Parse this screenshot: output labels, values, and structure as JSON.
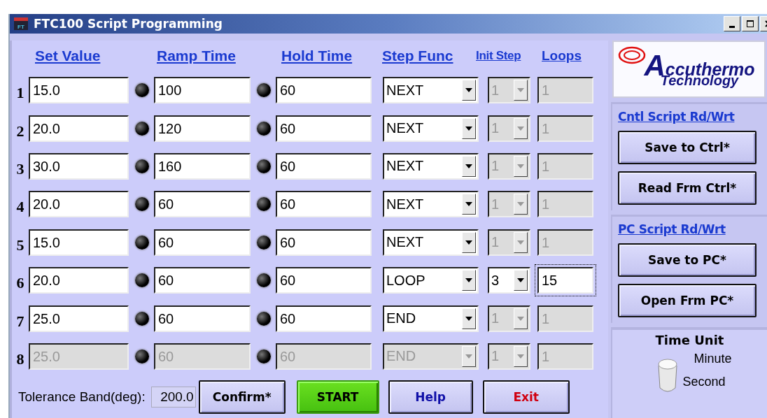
{
  "window": {
    "title": "FTC100 Script Programming",
    "icon_text": "FT"
  },
  "headers": [
    "Set Value",
    "Ramp Time",
    "Hold Time",
    "Step Func",
    "Init Step",
    "Loops"
  ],
  "rows": [
    {
      "number": "1",
      "set_value": "15.0",
      "ramp_time": "100",
      "hold_time": "60",
      "step_func": "NEXT",
      "init_step": "1",
      "loops": "1",
      "disabled": false,
      "loop_enabled": false,
      "focused": false
    },
    {
      "number": "2",
      "set_value": "20.0",
      "ramp_time": "120",
      "hold_time": "60",
      "step_func": "NEXT",
      "init_step": "1",
      "loops": "1",
      "disabled": false,
      "loop_enabled": false,
      "focused": false
    },
    {
      "number": "3",
      "set_value": "30.0",
      "ramp_time": "160",
      "hold_time": "60",
      "step_func": "NEXT",
      "init_step": "1",
      "loops": "1",
      "disabled": false,
      "loop_enabled": false,
      "focused": false
    },
    {
      "number": "4",
      "set_value": "20.0",
      "ramp_time": "60",
      "hold_time": "60",
      "step_func": "NEXT",
      "init_step": "1",
      "loops": "1",
      "disabled": false,
      "loop_enabled": false,
      "focused": false
    },
    {
      "number": "5",
      "set_value": "15.0",
      "ramp_time": "60",
      "hold_time": "60",
      "step_func": "NEXT",
      "init_step": "1",
      "loops": "1",
      "disabled": false,
      "loop_enabled": false,
      "focused": false
    },
    {
      "number": "6",
      "set_value": "20.0",
      "ramp_time": "60",
      "hold_time": "60",
      "step_func": "LOOP",
      "init_step": "3",
      "loops": "15",
      "disabled": false,
      "loop_enabled": true,
      "focused": true
    },
    {
      "number": "7",
      "set_value": "25.0",
      "ramp_time": "60",
      "hold_time": "60",
      "step_func": "END",
      "init_step": "1",
      "loops": "1",
      "disabled": false,
      "loop_enabled": false,
      "focused": false
    },
    {
      "number": "8",
      "set_value": "25.0",
      "ramp_time": "60",
      "hold_time": "60",
      "step_func": "END",
      "init_step": "1",
      "loops": "1",
      "disabled": true,
      "loop_enabled": false,
      "focused": false
    }
  ],
  "tolerance": {
    "label": "Tolerance Band(deg):",
    "value": "200.0"
  },
  "buttons": [
    {
      "label": "Confirm*",
      "kind": "plain"
    },
    {
      "label": "START",
      "kind": "go"
    },
    {
      "label": "Help",
      "kind": "help"
    },
    {
      "label": "Exit",
      "kind": "exit"
    }
  ],
  "logo": [
    "Accuthermo",
    "Technology"
  ],
  "sections": [
    {
      "title": "Cntl Script Rd/Wrt",
      "buttons": [
        "Save to Ctrl*",
        "Read Frm Ctrl*"
      ]
    },
    {
      "title": "PC Script Rd/Wrt",
      "buttons": [
        "Save to PC*",
        "Open Frm PC*"
      ]
    }
  ],
  "time_unit": {
    "title": "Time Unit",
    "options": [
      "Minute",
      "Second"
    ],
    "switch_down": true
  }
}
